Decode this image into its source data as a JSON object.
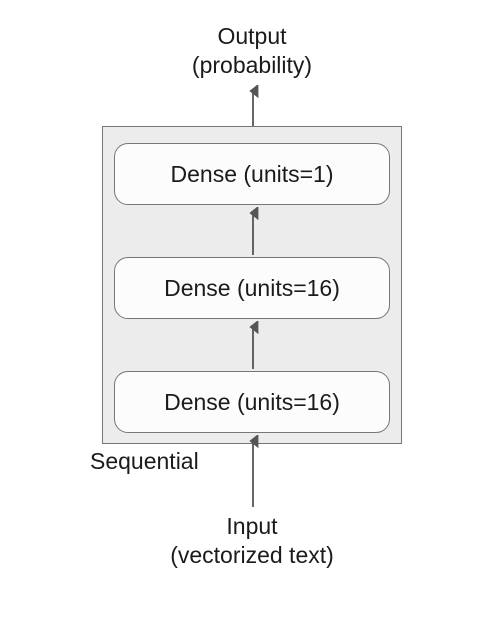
{
  "output": {
    "line1": "Output",
    "line2": "(probability)"
  },
  "input": {
    "line1": "Input",
    "line2": "(vectorized text)"
  },
  "model": {
    "label": "Sequential",
    "layers": [
      {
        "text": "Dense (units=16)"
      },
      {
        "text": "Dense (units=16)"
      },
      {
        "text": "Dense (units=1)"
      }
    ]
  },
  "chart_data": {
    "type": "table",
    "title": "Sequential neural network model",
    "nodes": [
      {
        "id": "input",
        "label": "Input (vectorized text)"
      },
      {
        "id": "dense1",
        "label": "Dense (units=16)"
      },
      {
        "id": "dense2",
        "label": "Dense (units=16)"
      },
      {
        "id": "dense3",
        "label": "Dense (units=1)"
      },
      {
        "id": "output",
        "label": "Output (probability)"
      }
    ],
    "edges": [
      [
        "input",
        "dense1"
      ],
      [
        "dense1",
        "dense2"
      ],
      [
        "dense2",
        "dense3"
      ],
      [
        "dense3",
        "output"
      ]
    ],
    "container": "Sequential"
  }
}
